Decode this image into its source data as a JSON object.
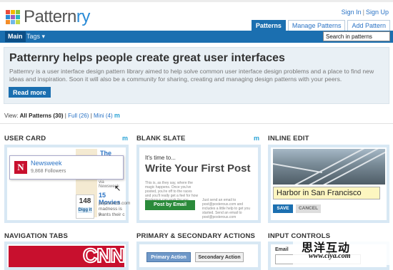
{
  "header": {
    "logo_text_main": "Pattern",
    "logo_text_accent": "ry",
    "logo_colors": [
      "#e94b3c",
      "#f5b700",
      "#8cc63f",
      "#2a8bd6",
      "#a05cbf",
      "#27b5c8",
      "#f28c28",
      "#6fb7e8",
      "#c2d94a"
    ],
    "auth": {
      "sign_in": "Sign In",
      "separator": "|",
      "sign_up": "Sign Up"
    },
    "tabs": [
      {
        "label": "Patterns",
        "active": true
      },
      {
        "label": "Manage Patterns",
        "active": false
      },
      {
        "label": "Add Pattern",
        "active": false
      }
    ]
  },
  "navbar": {
    "main_label": "Main",
    "tags_label": "Tags ▾",
    "search_value": "Search in patterns"
  },
  "hero": {
    "title": "Patternry helps people create great user interfaces",
    "body": "Patternry is a user interface design pattern library aimed to help solve common user interface design problems and a place to find new ideas and inspiration. Soon it will also be a community for sharing, creating and managing design patterns with your peers.",
    "button": "Read more"
  },
  "viewbar": {
    "prefix": "View:",
    "all": "All Patterns (30)",
    "sep1": "|",
    "full": "Full (26)",
    "sep2": "|",
    "mini": "Mini (4)",
    "m": "m"
  },
  "columns": {
    "user_card": {
      "title": "USER CARD",
      "m": "m"
    },
    "blank_slate": {
      "title": "BLANK SLATE",
      "m": "m"
    },
    "inline_edit": {
      "title": "INLINE EDIT"
    },
    "navigation_tabs": {
      "title": "NAVIGATION TABS"
    },
    "primary_secondary": {
      "title": "PRIMARY & SECONDARY ACTIONS"
    },
    "input_controls": {
      "title": "INPUT CONTROLS"
    }
  },
  "user_card_preview": {
    "headline": "The Cultu",
    "popup_logo": "N",
    "popup_name": "Newsweek",
    "popup_followers": "9,868 Followers",
    "via": "via Newsweek",
    "count": "148",
    "digg": "Digg it",
    "movies": "15 Movies",
    "lines": [
      "popcrunch.com",
      "madness is p",
      "wants their c"
    ]
  },
  "blank_slate_preview": {
    "intro": "It's time to...",
    "title": "Write Your First Post",
    "text_left": "This is, as they say, where the magic happens. Once you've posted, you're off to the races and you'll really get a feel for how Posterous can work for you.",
    "text_right": "Just send an email to post@posterous.com and includes a little help to get you started. Send an email to post@posterous.com",
    "button": "Post by Email"
  },
  "inline_edit_preview": {
    "field_value": "Harbor in San Francisco",
    "save": "SAVE",
    "cancel": "CANCEL"
  },
  "nav_tabs_preview": {
    "logo": "CNN"
  },
  "primary_preview": {
    "primary": "Primary Action",
    "secondary": "Secondary Action"
  },
  "input_preview": {
    "label": "Email"
  },
  "watermark": {
    "line1": "思洋互动",
    "line2": "www.ciya.com"
  }
}
